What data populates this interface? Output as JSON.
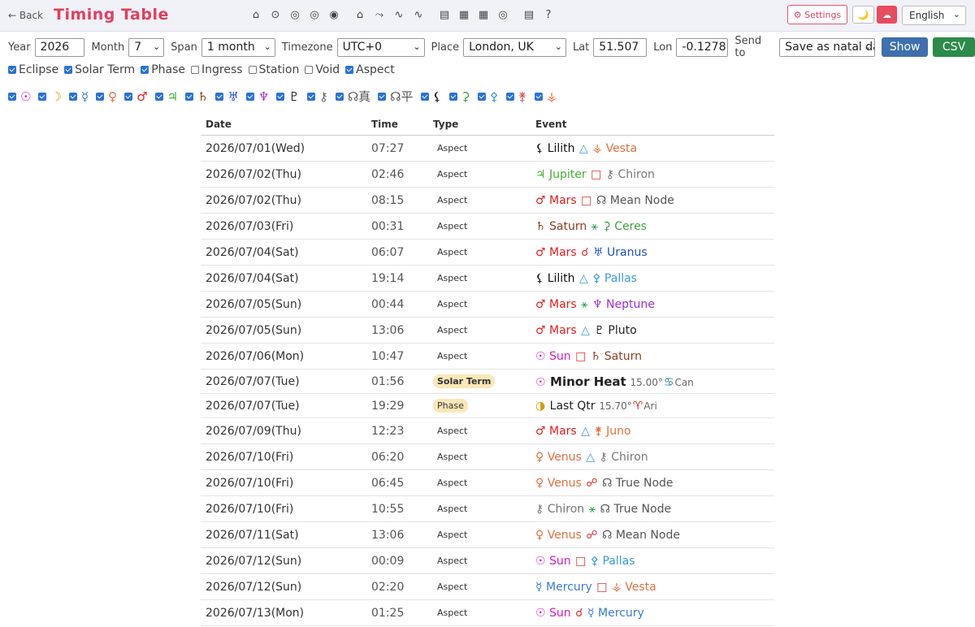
{
  "header": {
    "back": "← Back",
    "title": "Timing Table",
    "icons": [
      "⌂",
      "⊙",
      "◎",
      "◎",
      "◉",
      "⌂",
      "⤳",
      "∿",
      "∿",
      "▤",
      "▦",
      "▦",
      "◎",
      "▤",
      "?"
    ],
    "settings": "⚙ Settings",
    "theme_moon": "🌙",
    "theme_cloud": "☁",
    "language": "English"
  },
  "controls": {
    "year_label": "Year",
    "year": "2026",
    "month_label": "Month",
    "month": "7",
    "span_label": "Span",
    "span": "1 month",
    "timezone_label": "Timezone",
    "timezone": "UTC+0",
    "place_label": "Place",
    "place": "London, UK",
    "lat_label": "Lat",
    "lat": "51.507",
    "lon_label": "Lon",
    "lon": "-0.1278",
    "send_label": "Send to",
    "send": "Save as natal data",
    "show": "Show",
    "csv": "CSV"
  },
  "filters": [
    {
      "label": "Eclipse",
      "on": true
    },
    {
      "label": "Solar Term",
      "on": true
    },
    {
      "label": "Phase",
      "on": true
    },
    {
      "label": "Ingress",
      "on": false
    },
    {
      "label": "Station",
      "on": false
    },
    {
      "label": "Void",
      "on": false
    },
    {
      "label": "Aspect",
      "on": true
    }
  ],
  "planets": [
    {
      "g": "☉",
      "c": "#d020c0"
    },
    {
      "g": "☽",
      "c": "#d0a000"
    },
    {
      "g": "☿",
      "c": "#3a7ad8"
    },
    {
      "g": "♀",
      "c": "#e07040"
    },
    {
      "g": "♂",
      "c": "#e02020"
    },
    {
      "g": "♃",
      "c": "#40b030"
    },
    {
      "g": "♄",
      "c": "#8a4020"
    },
    {
      "g": "♅",
      "c": "#2050d0"
    },
    {
      "g": "♆",
      "c": "#a030d0"
    },
    {
      "g": "♇",
      "c": "#222222"
    },
    {
      "g": "⚷",
      "c": "#666666"
    },
    {
      "g": "☊真",
      "c": "#555555"
    },
    {
      "g": "☊平",
      "c": "#555555"
    },
    {
      "g": "⚸",
      "c": "#111111"
    },
    {
      "g": "⚳",
      "c": "#40a040"
    },
    {
      "g": "⚴",
      "c": "#3a9ad8"
    },
    {
      "g": "⚵",
      "c": "#e06060"
    },
    {
      "g": "⚶",
      "c": "#e07040"
    }
  ],
  "table": {
    "headers": [
      "Date",
      "Time",
      "Type",
      "Event"
    ],
    "rows": [
      {
        "date": "2026/07/01(Wed)",
        "time": "07:27",
        "type": "Aspect",
        "kind": "aspect",
        "ev": [
          {
            "t": "⚸ Lilith",
            "c": "#111111"
          },
          {
            "t": " △ ",
            "c": "#3a9ad8"
          },
          {
            "t": "⚶ Vesta",
            "c": "#e07040"
          }
        ]
      },
      {
        "date": "2026/07/02(Thu)",
        "time": "02:46",
        "type": "Aspect",
        "kind": "aspect",
        "ev": [
          {
            "t": "♃ Jupiter",
            "c": "#40b030"
          },
          {
            "t": " □ ",
            "c": "#e03030"
          },
          {
            "t": "⚷ Chiron",
            "c": "#777777"
          }
        ]
      },
      {
        "date": "2026/07/02(Thu)",
        "time": "08:15",
        "type": "Aspect",
        "kind": "aspect",
        "ev": [
          {
            "t": "♂ Mars",
            "c": "#e02020"
          },
          {
            "t": " □ ",
            "c": "#e03030"
          },
          {
            "t": "☊ Mean Node",
            "c": "#555555"
          }
        ]
      },
      {
        "date": "2026/07/03(Fri)",
        "time": "00:31",
        "type": "Aspect",
        "kind": "aspect",
        "ev": [
          {
            "t": "♄ Saturn",
            "c": "#8a4020"
          },
          {
            "t": " ⚹ ",
            "c": "#30a050"
          },
          {
            "t": "⚳ Ceres",
            "c": "#40a040"
          }
        ]
      },
      {
        "date": "2026/07/04(Sat)",
        "time": "06:07",
        "type": "Aspect",
        "kind": "aspect",
        "ev": [
          {
            "t": "♂ Mars",
            "c": "#e02020"
          },
          {
            "t": " ☌ ",
            "c": "#e03030"
          },
          {
            "t": "♅ Uranus",
            "c": "#2050d0"
          }
        ]
      },
      {
        "date": "2026/07/04(Sat)",
        "time": "19:14",
        "type": "Aspect",
        "kind": "aspect",
        "ev": [
          {
            "t": "⚸ Lilith",
            "c": "#111111"
          },
          {
            "t": " △ ",
            "c": "#3a9ad8"
          },
          {
            "t": "⚴ Pallas",
            "c": "#3a9ad8"
          }
        ]
      },
      {
        "date": "2026/07/05(Sun)",
        "time": "00:44",
        "type": "Aspect",
        "kind": "aspect",
        "ev": [
          {
            "t": "♂ Mars",
            "c": "#e02020"
          },
          {
            "t": " ⚹ ",
            "c": "#30a050"
          },
          {
            "t": "♆ Neptune",
            "c": "#a030d0"
          }
        ]
      },
      {
        "date": "2026/07/05(Sun)",
        "time": "13:06",
        "type": "Aspect",
        "kind": "aspect",
        "ev": [
          {
            "t": "♂ Mars",
            "c": "#e02020"
          },
          {
            "t": " △ ",
            "c": "#3a9ad8"
          },
          {
            "t": "♇ Pluto",
            "c": "#222222"
          }
        ]
      },
      {
        "date": "2026/07/06(Mon)",
        "time": "10:47",
        "type": "Aspect",
        "kind": "aspect",
        "ev": [
          {
            "t": "☉ Sun",
            "c": "#d020c0"
          },
          {
            "t": " □ ",
            "c": "#e03030"
          },
          {
            "t": "♄ Saturn",
            "c": "#8a4020"
          }
        ]
      },
      {
        "date": "2026/07/07(Tue)",
        "time": "01:56",
        "type": "Solar Term",
        "kind": "solar",
        "ev": [
          {
            "t": "☉ ",
            "c": "#d020c0"
          },
          {
            "t": "Minor Heat",
            "c": "#222222",
            "b": true
          },
          {
            "t": " 15.00°",
            "c": "#666666",
            "s": true
          },
          {
            "t": "♋",
            "c": "#2080b0"
          },
          {
            "t": "Can",
            "c": "#666666",
            "s": true
          }
        ]
      },
      {
        "date": "2026/07/07(Tue)",
        "time": "19:29",
        "type": "Phase",
        "kind": "phase",
        "ev": [
          {
            "t": "◑ ",
            "c": "#d0a000"
          },
          {
            "t": "Last Qtr",
            "c": "#222222"
          },
          {
            "t": " 15.70°",
            "c": "#666666",
            "s": true
          },
          {
            "t": "♈",
            "c": "#e02020"
          },
          {
            "t": "Ari",
            "c": "#666666",
            "s": true
          }
        ]
      },
      {
        "date": "2026/07/09(Thu)",
        "time": "12:23",
        "type": "Aspect",
        "kind": "aspect",
        "ev": [
          {
            "t": "♂ Mars",
            "c": "#e02020"
          },
          {
            "t": " △ ",
            "c": "#3a9ad8"
          },
          {
            "t": "⚵ Juno",
            "c": "#e07040"
          }
        ]
      },
      {
        "date": "2026/07/10(Fri)",
        "time": "06:20",
        "type": "Aspect",
        "kind": "aspect",
        "ev": [
          {
            "t": "♀ Venus",
            "c": "#e07040"
          },
          {
            "t": " △ ",
            "c": "#3a9ad8"
          },
          {
            "t": "⚷ Chiron",
            "c": "#777777"
          }
        ]
      },
      {
        "date": "2026/07/10(Fri)",
        "time": "06:45",
        "type": "Aspect",
        "kind": "aspect",
        "ev": [
          {
            "t": "♀ Venus",
            "c": "#e07040"
          },
          {
            "t": " ☍ ",
            "c": "#e03030"
          },
          {
            "t": "☊ True Node",
            "c": "#555555"
          }
        ]
      },
      {
        "date": "2026/07/10(Fri)",
        "time": "10:55",
        "type": "Aspect",
        "kind": "aspect",
        "ev": [
          {
            "t": "⚷ Chiron",
            "c": "#777777"
          },
          {
            "t": " ⚹ ",
            "c": "#30a050"
          },
          {
            "t": "☊ True Node",
            "c": "#555555"
          }
        ]
      },
      {
        "date": "2026/07/11(Sat)",
        "time": "13:06",
        "type": "Aspect",
        "kind": "aspect",
        "ev": [
          {
            "t": "♀ Venus",
            "c": "#e07040"
          },
          {
            "t": " ☍ ",
            "c": "#e03030"
          },
          {
            "t": "☊ Mean Node",
            "c": "#555555"
          }
        ]
      },
      {
        "date": "2026/07/12(Sun)",
        "time": "00:09",
        "type": "Aspect",
        "kind": "aspect",
        "ev": [
          {
            "t": "☉ Sun",
            "c": "#d020c0"
          },
          {
            "t": " □ ",
            "c": "#e03030"
          },
          {
            "t": "⚴ Pallas",
            "c": "#3a9ad8"
          }
        ]
      },
      {
        "date": "2026/07/12(Sun)",
        "time": "02:20",
        "type": "Aspect",
        "kind": "aspect",
        "ev": [
          {
            "t": "☿ Mercury",
            "c": "#3a7ad8"
          },
          {
            "t": " □ ",
            "c": "#e03030"
          },
          {
            "t": "⚶ Vesta",
            "c": "#e07040"
          }
        ]
      },
      {
        "date": "2026/07/13(Mon)",
        "time": "01:25",
        "type": "Aspect",
        "kind": "aspect",
        "ev": [
          {
            "t": "☉ Sun",
            "c": "#d020c0"
          },
          {
            "t": " ☌ ",
            "c": "#e03030"
          },
          {
            "t": "☿ Mercury",
            "c": "#3a7ad8"
          }
        ]
      }
    ]
  }
}
